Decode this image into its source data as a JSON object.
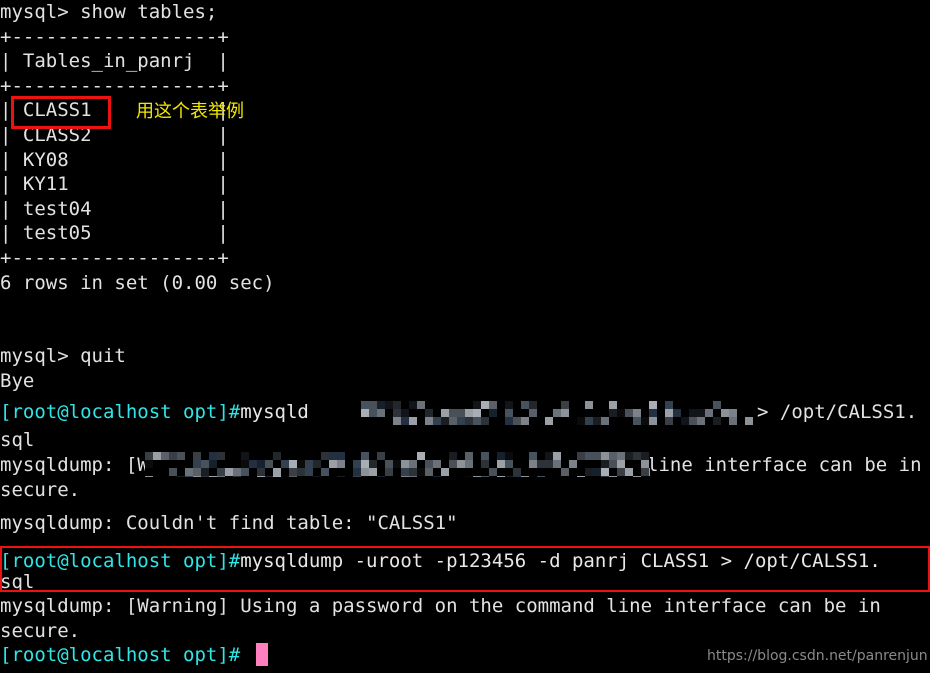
{
  "terminal": {
    "background_color": "#000000",
    "text_color": "#e2e2e2",
    "prompt_color": "#2ee6e6",
    "annotation_color": "#ee1111",
    "note_color": "#f2e800",
    "cursor_color": "#ff7fbf",
    "watermark_color": "#8a8a8a"
  },
  "lines": {
    "l01": "mysql> show tables;",
    "l02": "+------------------+",
    "l03": "| Tables_in_panrj  |",
    "l04": "+------------------+",
    "l05": "| CLASS1           |",
    "l06": "| CLASS2           |",
    "l07": "| KY08             |",
    "l08": "| KY11             |",
    "l09": "| test04           |",
    "l10": "| test05           |",
    "l11": "+------------------+",
    "l12": "6 rows in set (0.00 sec)",
    "l13": "",
    "l14": "mysql> quit",
    "l15": "Bye",
    "l16_prompt": "[root@localhost opt]#",
    "l16_cmd": "mysqld",
    "l16_tail": "> /opt/CALSS1.",
    "l17": "sql",
    "l18_head": "mysqldump: [Warning]",
    "l18_tail": "line interface can be in",
    "l19": "secure.",
    "l20": "mysqldump: Couldn't find table: \"CALSS1\"",
    "l21_prompt": "[root@localhost opt]#",
    "l21_cmd": "mysqldump -uroot -p123456 -d panrj CLASS1 > /opt/CALSS1.",
    "l22": "sql",
    "l23": "mysqldump: [Warning] Using a password on the command line interface can be in",
    "l24": "secure.",
    "l25_prompt": "[root@localhost opt]#"
  },
  "annotations": {
    "class1_note": "用这个表举例"
  },
  "watermark": {
    "text": "https://blog.csdn.net/panrenjun"
  }
}
